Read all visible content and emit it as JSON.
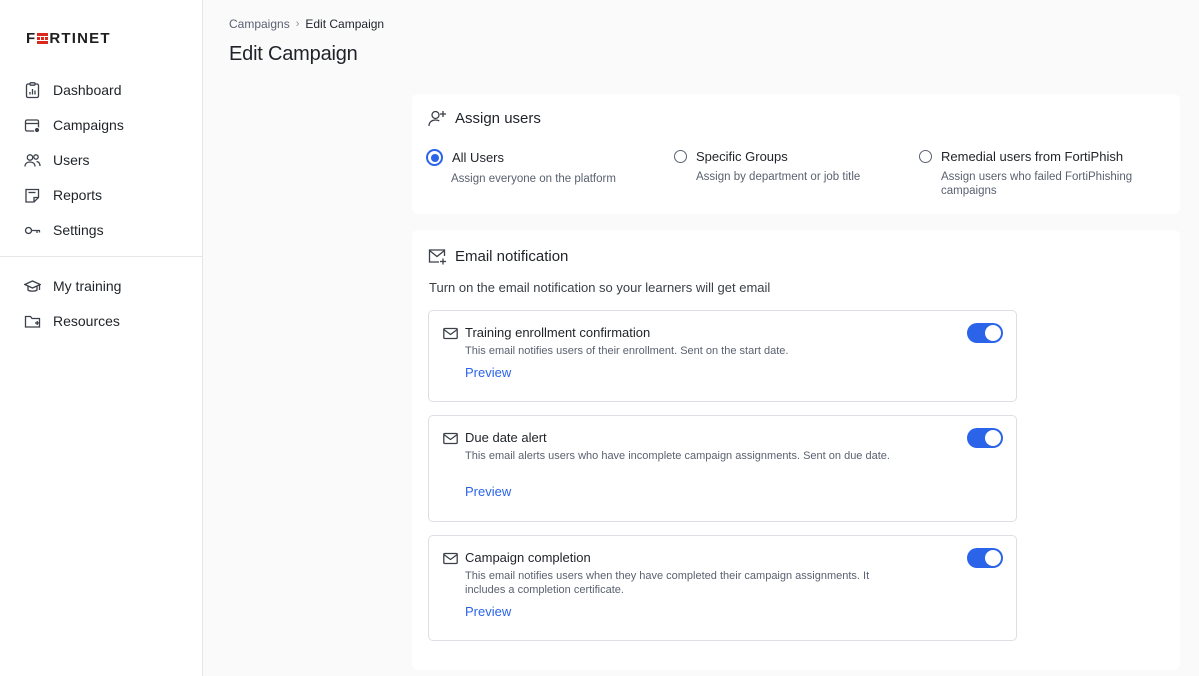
{
  "brand": {
    "name": "FORTINET",
    "accent": "#da291c"
  },
  "sidebar": {
    "items": [
      {
        "label": "Dashboard",
        "icon": "dashboard-icon"
      },
      {
        "label": "Campaigns",
        "icon": "campaigns-icon"
      },
      {
        "label": "Users",
        "icon": "users-icon"
      },
      {
        "label": "Reports",
        "icon": "reports-icon"
      },
      {
        "label": "Settings",
        "icon": "settings-key-icon"
      }
    ],
    "secondary": [
      {
        "label": "My training",
        "icon": "graduation-cap-icon"
      },
      {
        "label": "Resources",
        "icon": "folder-icon"
      }
    ]
  },
  "breadcrumb": {
    "parent": "Campaigns",
    "current": "Edit Campaign"
  },
  "page": {
    "title": "Edit Campaign"
  },
  "assign": {
    "title": "Assign users",
    "options": [
      {
        "label": "All Users",
        "description": "Assign everyone on the platform",
        "checked": true
      },
      {
        "label": "Specific Groups",
        "description": "Assign by department or job title",
        "checked": false
      },
      {
        "label": "Remedial users from FortiPhish",
        "description": "Assign users who failed FortiPhishing campaigns",
        "checked": false
      }
    ]
  },
  "email": {
    "title": "Email notification",
    "subtitle": "Turn on the email notification so your learners will get email",
    "notifications": [
      {
        "title": "Training enrollment confirmation",
        "description": "This email notifies users of their enrollment. Sent on the start date.",
        "preview": "Preview",
        "enabled": true
      },
      {
        "title": "Due date alert",
        "description": "This email alerts users who have incomplete campaign assignments. Sent on due date.",
        "preview": "Preview",
        "enabled": true
      },
      {
        "title": "Campaign completion",
        "description": "This email notifies users when they have completed their campaign assignments. It includes a completion certificate.",
        "preview": "Preview",
        "enabled": true
      }
    ]
  },
  "colors": {
    "primary": "#2b64e8",
    "text": "#1f2328",
    "muted": "#5a6270"
  }
}
